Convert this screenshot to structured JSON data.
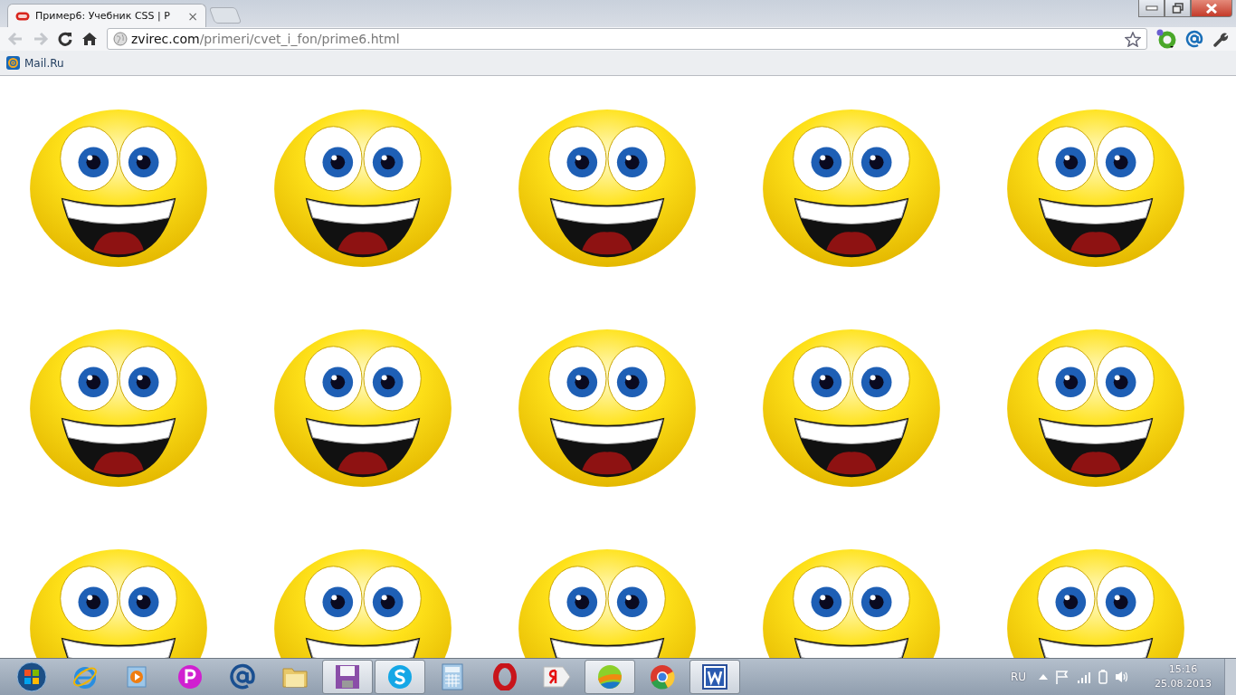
{
  "window": {
    "tab": {
      "title": "Пример6: Учебник CSS | Р",
      "close": "×",
      "selected": true
    }
  },
  "toolbar": {
    "url_domain": "zvirec.com",
    "url_path": "/primeri/cvet_i_fon/prime6.html",
    "back_disabled": true,
    "forward_disabled": true
  },
  "bookmarks": [
    {
      "label": "Mail.Ru"
    }
  ],
  "taskbar": {
    "apps": [
      {
        "kind": "start",
        "running": false
      },
      {
        "kind": "ie",
        "running": false
      },
      {
        "kind": "media",
        "running": false
      },
      {
        "kind": "p",
        "running": false
      },
      {
        "kind": "mail",
        "running": false
      },
      {
        "kind": "folder",
        "running": false
      },
      {
        "kind": "floppy",
        "running": true
      },
      {
        "kind": "skype",
        "running": true
      },
      {
        "kind": "calculator",
        "running": false
      },
      {
        "kind": "opera",
        "running": false
      },
      {
        "kind": "yandex",
        "running": false
      },
      {
        "kind": "ball",
        "running": true
      },
      {
        "kind": "chrome",
        "running": false
      },
      {
        "kind": "word",
        "running": true
      }
    ],
    "tray": {
      "language": "RU",
      "time": "15:16",
      "date": "25.08.2013"
    }
  }
}
